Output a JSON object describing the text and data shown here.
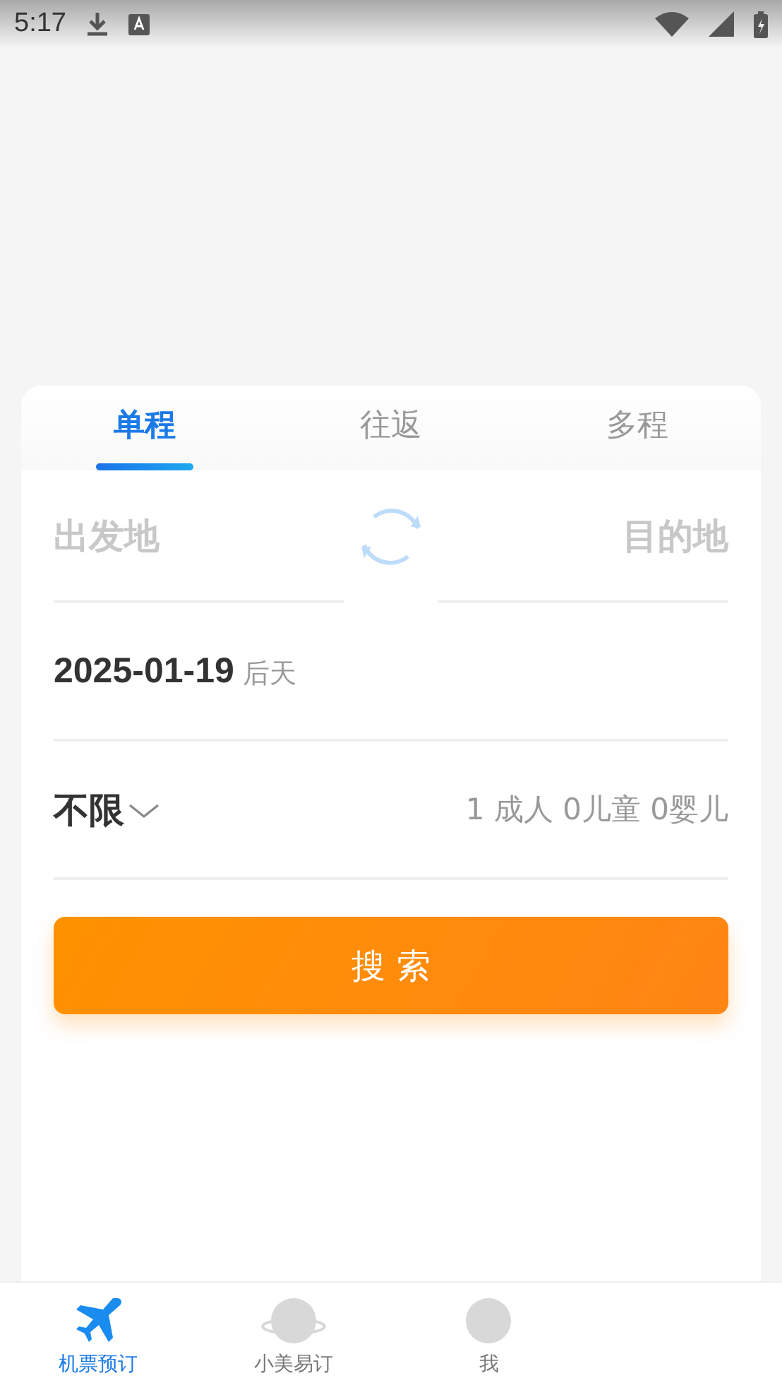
{
  "status_bar": {
    "time": "5:17"
  },
  "tabs": [
    {
      "label": "单程",
      "selected": true
    },
    {
      "label": "往返",
      "selected": false
    },
    {
      "label": "多程",
      "selected": false
    }
  ],
  "route": {
    "from_placeholder": "出发地",
    "to_placeholder": "目的地"
  },
  "date": {
    "value": "2025-01-19",
    "note": "后天"
  },
  "cabin": {
    "value": "不限"
  },
  "passengers": "1 成人 0儿童 0婴儿",
  "search_button": "搜 索",
  "bottom_nav": [
    {
      "label": "机票预订",
      "selected": true,
      "kind": "plane"
    },
    {
      "label": "小美易订",
      "selected": false,
      "kind": "planet"
    },
    {
      "label": "我",
      "selected": false,
      "kind": "circle"
    }
  ]
}
